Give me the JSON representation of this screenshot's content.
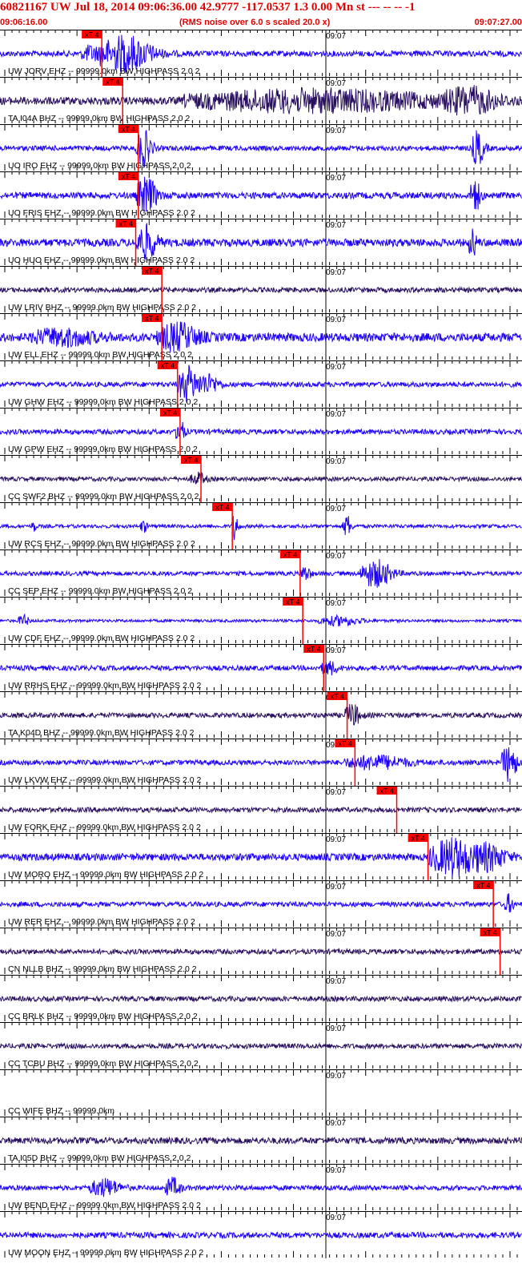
{
  "header": {
    "title": "60821167 UW Jul 18, 2014 09:06:36.00   42.9777 -117.0537  1.3 0.00 Mn st --- -- --  -1",
    "start_time": "09:06:16.00",
    "note": "(RMS noise over 6.0 s scaled 20.0 x)",
    "end_time": "09:07:27.00"
  },
  "chart_data": {
    "type": "line",
    "title": "60821167 UW Jul 18, 2014 09:06:36.00   42.9777 -117.0537  1.3 0.00 Mn st --- -- --  -1",
    "x_range": [
      "09:06:16.00",
      "09:07:27.00"
    ],
    "center_tick_label": "09:07",
    "pick_label": "xT 4",
    "colors": {
      "blue": "#1e00ff",
      "dark": "#2a1060",
      "pick": "#ff0000",
      "axis": "#000000",
      "header": "#e00000"
    },
    "series": [
      {
        "label": "UW JORV EHZ -- 99999.0km BW  HIGHPASS  2.0  2",
        "color": "blue",
        "noise": 0.16,
        "pick": 0.195,
        "bursts": [
          [
            0.24,
            0.05,
            1.0
          ],
          [
            0.175,
            0.02,
            0.4
          ]
        ]
      },
      {
        "label": "TA I04A BHZ -- 99999.0km BW  HIGHPASS  2.0  2",
        "color": "dark",
        "noise": 0.22,
        "pick": 0.235,
        "bursts": [
          [
            0.6,
            0.25,
            0.55
          ],
          [
            0.9,
            0.05,
            0.6
          ]
        ]
      },
      {
        "label": "UO IRO EHZ -- 99999.0km BW  HIGHPASS  2.0  2",
        "color": "blue",
        "noise": 0.14,
        "pick": 0.265,
        "bursts": [
          [
            0.275,
            0.015,
            1.0
          ],
          [
            0.915,
            0.012,
            1.0
          ]
        ]
      },
      {
        "label": "UO FRIS EHZ -- 99999.0km BW  HIGHPASS  2.0  2",
        "color": "blue",
        "noise": 0.18,
        "pick": 0.265,
        "bursts": [
          [
            0.28,
            0.02,
            1.0
          ],
          [
            0.91,
            0.01,
            0.9
          ]
        ]
      },
      {
        "label": "UO HUO EHZ -- 99999.0km BW  HIGHPASS  2.0  2",
        "color": "blue",
        "noise": 0.22,
        "pick": 0.26,
        "bursts": [
          [
            0.28,
            0.02,
            0.9
          ],
          [
            0.905,
            0.008,
            0.7
          ]
        ]
      },
      {
        "label": "UW LRIV BHZ -- 99999.0km BW  HIGHPASS  2.0  2",
        "color": "dark",
        "noise": 0.14,
        "pick": 0.31,
        "bursts": []
      },
      {
        "label": "UW ELL EHZ -- 99999.0km BW  HIGHPASS  2.0  2",
        "color": "blue",
        "noise": 0.24,
        "pick": 0.31,
        "bursts": [
          [
            0.34,
            0.04,
            0.7
          ],
          [
            0.12,
            0.06,
            0.4
          ]
        ]
      },
      {
        "label": "UW GHW EHZ -- 99999.0km BW  HIGHPASS  2.0  2",
        "color": "blue",
        "noise": 0.14,
        "pick": 0.34,
        "bursts": [
          [
            0.36,
            0.02,
            1.0
          ],
          [
            0.4,
            0.02,
            0.5
          ]
        ]
      },
      {
        "label": "UW GPW EHZ -- 99999.0km BW  HIGHPASS  2.0  2",
        "color": "blue",
        "noise": 0.14,
        "pick": 0.345,
        "bursts": [
          [
            0.345,
            0.008,
            0.7
          ]
        ]
      },
      {
        "label": "CC SWF2 BHZ -- 99999.0km BW  HIGHPASS  2.0  2",
        "color": "dark",
        "noise": 0.12,
        "pick": 0.385,
        "bursts": [
          [
            0.38,
            0.015,
            0.3
          ]
        ]
      },
      {
        "label": "UW RCS EHZ -- 99999.0km BW  HIGHPASS  2.0  2",
        "color": "blue",
        "noise": 0.1,
        "pick": 0.445,
        "bursts": [
          [
            0.45,
            0.006,
            0.8
          ],
          [
            0.665,
            0.008,
            0.6
          ],
          [
            0.065,
            0.004,
            0.3
          ],
          [
            0.275,
            0.006,
            0.35
          ]
        ]
      },
      {
        "label": "CC SEP EHZ -- 99999.0km BW  HIGHPASS  2.0  2",
        "color": "blue",
        "noise": 0.12,
        "pick": 0.575,
        "bursts": [
          [
            0.585,
            0.01,
            0.4
          ],
          [
            0.72,
            0.03,
            0.75
          ]
        ]
      },
      {
        "label": "UW CDF EHZ -- 99999.0km BW  HIGHPASS  2.0  2",
        "color": "blue",
        "noise": 0.08,
        "pick": 0.58,
        "bursts": [
          [
            0.045,
            0.01,
            0.3
          ],
          [
            0.65,
            0.04,
            0.25
          ]
        ]
      },
      {
        "label": "UW RRHS EHZ -- 99999.0km BW  HIGHPASS  2.0  2",
        "color": "blue",
        "noise": 0.14,
        "pick": 0.62,
        "bursts": [
          [
            0.63,
            0.015,
            0.35
          ]
        ]
      },
      {
        "label": "TA K04D BHZ -- 99999.0km BW  HIGHPASS  2.0  2",
        "color": "dark",
        "noise": 0.14,
        "pick": 0.665,
        "bursts": [
          [
            0.675,
            0.015,
            0.6
          ]
        ]
      },
      {
        "label": "UW LKVW EHZ -- 99999.0km BW  HIGHPASS  2.0  2",
        "color": "blue",
        "noise": 0.14,
        "pick": 0.68,
        "bursts": [
          [
            0.72,
            0.06,
            0.35
          ],
          [
            0.975,
            0.015,
            1.0
          ]
        ]
      },
      {
        "label": "UW FORK EHZ -- 99999.0km BW  HIGHPASS  2.0  2",
        "color": "dark",
        "noise": 0.14,
        "pick": 0.76,
        "bursts": []
      },
      {
        "label": "UW MORO EHZ -- 99999.0km BW  HIGHPASS  2.0  2",
        "color": "blue",
        "noise": 0.2,
        "pick": 0.82,
        "bursts": [
          [
            0.87,
            0.05,
            1.0
          ],
          [
            0.94,
            0.03,
            0.55
          ]
        ]
      },
      {
        "label": "UW RER EHZ -- 99999.0km BW  HIGHPASS  2.0  2",
        "color": "blue",
        "noise": 0.14,
        "pick": 0.945,
        "bursts": [
          [
            0.975,
            0.008,
            0.5
          ]
        ]
      },
      {
        "label": "CN NLLB BHZ -- 99999.0km BW  HIGHPASS  2.0  2",
        "color": "dark",
        "noise": 0.14,
        "pick": 0.958,
        "bursts": []
      },
      {
        "label": "CC BRLK BHZ -- 99999.0km BW  HIGHPASS  2.0  2",
        "color": "dark",
        "noise": 0.14,
        "pick": null,
        "bursts": []
      },
      {
        "label": "CC TCBU BHZ -- 99999.0km BW  HIGHPASS  2.0  2",
        "color": "dark",
        "noise": 0.14,
        "pick": null,
        "bursts": []
      },
      {
        "label": "CC WIFE BHZ -- 99999.0km",
        "color": "none",
        "noise": 0,
        "pick": null,
        "bursts": []
      },
      {
        "label": "TA I05D BHZ -- 99999.0km BW  HIGHPASS  2.0  2",
        "color": "dark",
        "noise": 0.18,
        "pick": null,
        "bursts": []
      },
      {
        "label": "UW BEND EHZ -- 99999.0km BW  HIGHPASS  2.0  2",
        "color": "blue",
        "noise": 0.14,
        "pick": null,
        "bursts": [
          [
            0.2,
            0.03,
            0.45
          ],
          [
            0.33,
            0.015,
            0.5
          ]
        ]
      },
      {
        "label": "UW MOON EHZ -- 99999.0km BW  HIGHPASS  2.0  2",
        "color": "blue",
        "noise": 0.16,
        "pick": null,
        "bursts": []
      }
    ]
  }
}
